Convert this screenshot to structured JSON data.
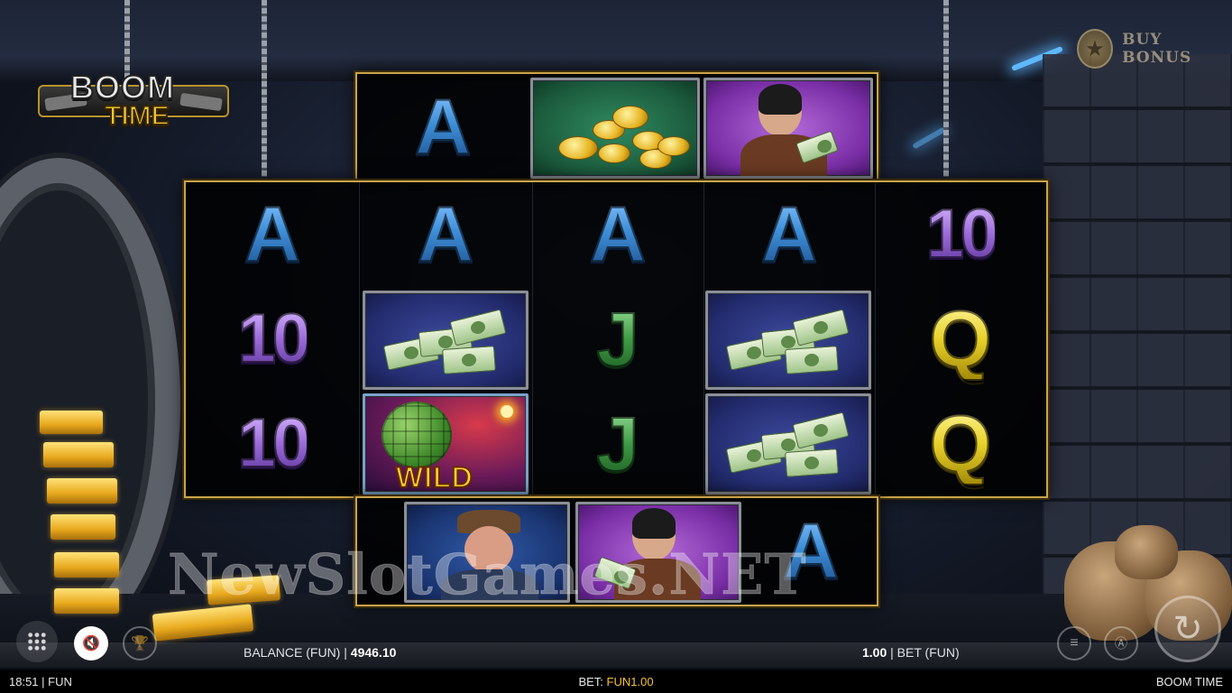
{
  "game": {
    "logo_line1": "BOOM",
    "logo_line2": "TIME",
    "buy_bonus_label": "BUY BONUS"
  },
  "reels": {
    "top_row": [
      "A",
      "gold-coins",
      "masked-robber"
    ],
    "main_grid": [
      [
        "A",
        "10",
        "10"
      ],
      [
        "A",
        "cash-stack",
        "wild-grenade"
      ],
      [
        "A",
        "J",
        "J"
      ],
      [
        "A",
        "cash-stack",
        "cash-stack"
      ],
      [
        "10",
        "Q",
        "Q"
      ]
    ],
    "bottom_row": [
      "mobster-boss",
      "masked-robber",
      "A"
    ],
    "wild_label": "WILD"
  },
  "watermark": "NewSlotGames.NET",
  "controls": {
    "balance_label": "BALANCE (FUN)",
    "balance_value": "4946.10",
    "bet_value": "1.00",
    "bet_label": "BET  (FUN)"
  },
  "status_bar": {
    "time": "18:51",
    "mode": "FUN",
    "bet_label": "BET:",
    "bet_value": "FUN1.00",
    "game_name": "BOOM TIME"
  },
  "colors": {
    "frame_gold": "#c9a44a",
    "status_bet_value": "#f6c23a",
    "card_A": "#3f8fd8",
    "card_10": "#9a6ad8",
    "card_J": "#3f9a45",
    "card_Q": "#e8d12a"
  },
  "icons": [
    "buy-bonus-star-coin-icon",
    "menu-grid-icon",
    "sound-muted-icon",
    "trophy-icon",
    "coin-stack-icon",
    "autoplay-icon",
    "spin-icon"
  ]
}
